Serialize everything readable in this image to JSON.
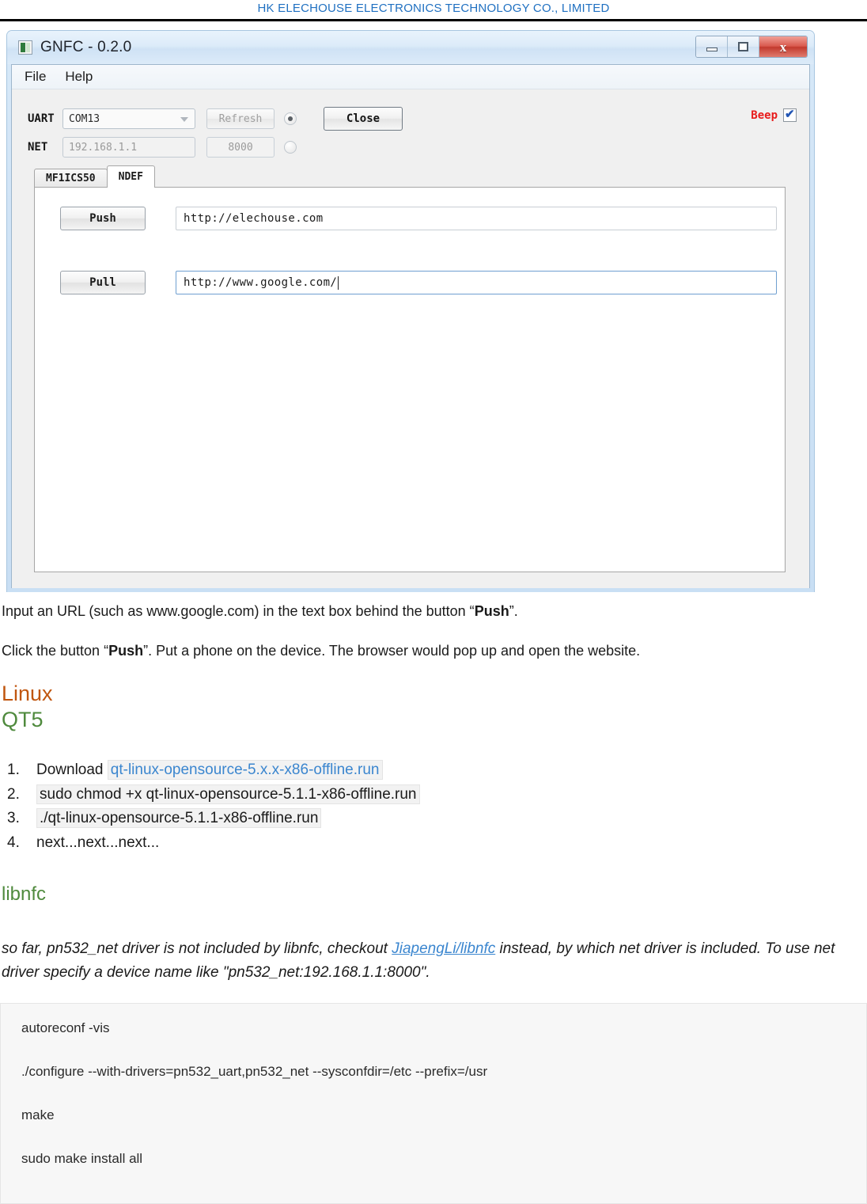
{
  "page_header": {
    "company": "HK ELECHOUSE ELECTRONICS TECHNOLOGY CO., LIMITED",
    "color": "#1F70C1"
  },
  "app_window": {
    "title": "GNFC - 0.2.0",
    "icon": "app-icon",
    "window_controls": {
      "minimize": "–",
      "maximize": "□",
      "close": "x"
    },
    "menu": [
      {
        "label": "File"
      },
      {
        "label": "Help"
      }
    ],
    "connection": {
      "uart": {
        "label": "UART",
        "port_value": "COM13",
        "refresh_label": "Refresh",
        "radio_selected": true
      },
      "net": {
        "label": "NET",
        "ip_value": "192.168.1.1",
        "port_value": "8000",
        "radio_selected": false
      },
      "close_label": "Close",
      "beep": {
        "label": "Beep",
        "checked": true,
        "color": "#e81b1b"
      }
    },
    "tabs": [
      {
        "label": "MF1ICS50",
        "active": false
      },
      {
        "label": "NDEF",
        "active": true
      }
    ],
    "ndef": {
      "push": {
        "button_label": "Push",
        "url_value": "http://elechouse.com"
      },
      "pull": {
        "button_label": "Pull",
        "url_value": "http://www.google.com/",
        "focused": true
      }
    }
  },
  "doc": {
    "para1_a": "Input an URL (such as www.google.com) in the text box behind the button “",
    "para1_b": "Push",
    "para1_c": "”.",
    "para2_a": "Click the button “",
    "para2_b": "Push",
    "para2_c": "”. Put a phone on the device. The browser would pop up and open the website.",
    "heading_linux": "Linux",
    "heading_qt5": "QT5",
    "steps": [
      {
        "prefix": "Download ",
        "code": "qt-linux-opensource-5.x.x-x86-offline.run",
        "is_link": true
      },
      {
        "prefix": "",
        "code": "sudo chmod +x qt-linux-opensource-5.1.1-x86-offline.run",
        "is_link": false
      },
      {
        "prefix": "",
        "code": "./qt-linux-opensource-5.1.1-x86-offline.run",
        "is_link": false
      },
      {
        "prefix": "next...next...next...",
        "code": "",
        "is_link": false
      }
    ],
    "heading_libnfc": "libnfc",
    "italic_a": "so far, pn532_net driver is not included by libnfc, checkout ",
    "italic_link": "JiapengLi/libnfc",
    "italic_b": " instead, by which net driver is included. To use net driver specify a device name like \"pn532_net:192.168.1.1:8000\".",
    "code_lines": [
      "autoreconf -vis",
      "./configure --with-drivers=pn532_uart,pn532_net --sysconfdir=/etc --prefix=/usr",
      "make",
      "sudo make install all"
    ]
  }
}
